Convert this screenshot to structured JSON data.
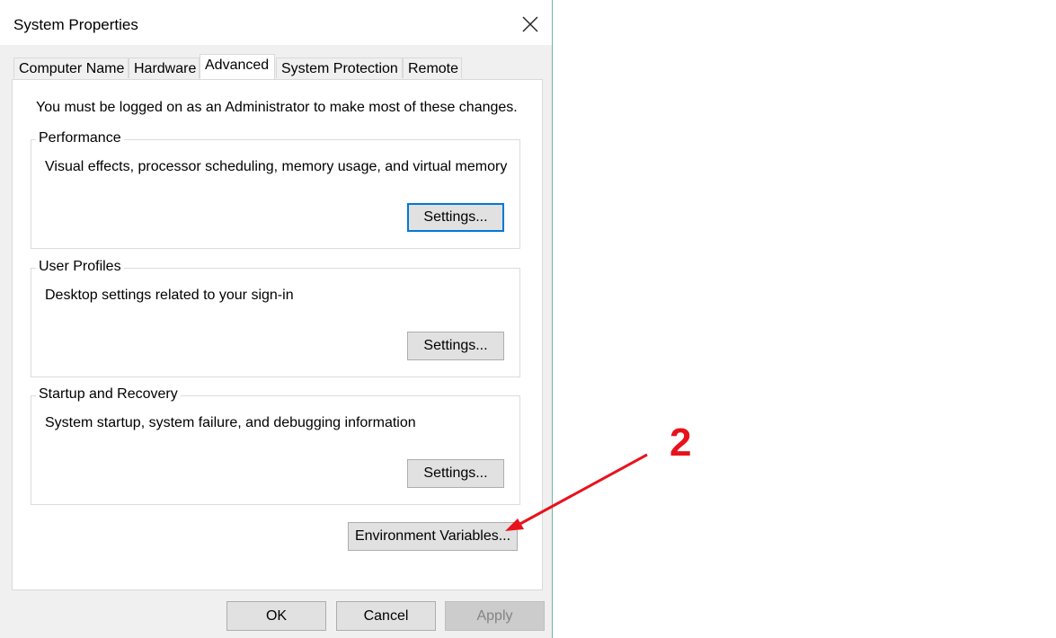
{
  "window": {
    "title": "System Properties"
  },
  "tabs": [
    {
      "label": "Computer Name",
      "active": false
    },
    {
      "label": "Hardware",
      "active": false
    },
    {
      "label": "Advanced",
      "active": true
    },
    {
      "label": "System Protection",
      "active": false
    },
    {
      "label": "Remote",
      "active": false
    }
  ],
  "advanced": {
    "admin_note": "You must be logged on as an Administrator to make most of these changes.",
    "groups": [
      {
        "title": "Performance",
        "description": "Visual effects, processor scheduling, memory usage, and virtual memory",
        "button": "Settings..."
      },
      {
        "title": "User Profiles",
        "description": "Desktop settings related to your sign-in",
        "button": "Settings..."
      },
      {
        "title": "Startup and Recovery",
        "description": "System startup, system failure, and debugging information",
        "button": "Settings..."
      }
    ],
    "env_button": "Environment Variables..."
  },
  "footer": {
    "ok": "OK",
    "cancel": "Cancel",
    "apply": "Apply"
  },
  "annotation": {
    "step": "2",
    "color": "#e8121c"
  },
  "colors": {
    "focus": "#0078d7",
    "window_border": "#6fb7a6"
  }
}
